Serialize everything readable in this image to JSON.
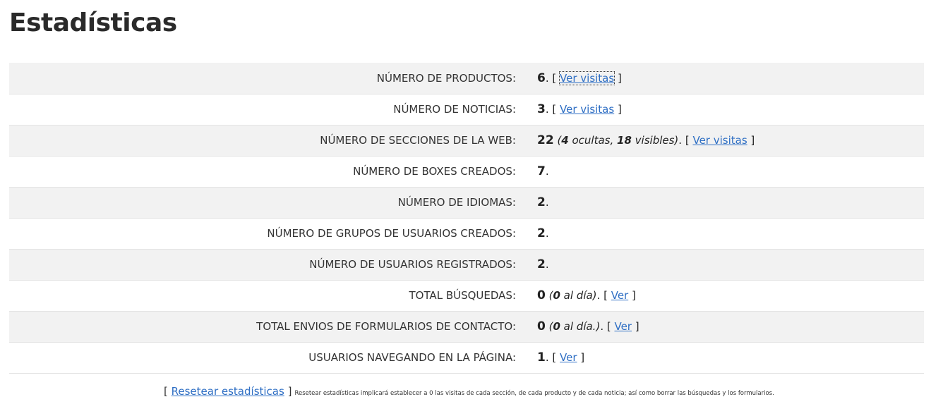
{
  "page": {
    "title": "Estadísticas"
  },
  "rows": [
    {
      "label": "NÚMERO DE PRODUCTOS:",
      "value": "6",
      "tail": ".",
      "link_open": " [ ",
      "link": "Ver visitas",
      "link_close": " ]"
    },
    {
      "label": "NÚMERO DE NOTICIAS:",
      "value": "3",
      "tail": ".",
      "link_open": " [ ",
      "link": "Ver visitas",
      "link_close": " ]"
    },
    {
      "label": "NÚMERO DE SECCIONES DE LA WEB:",
      "value": "22",
      "detail_open": " (",
      "hidden_count": "4",
      "hidden_text": " ocultas, ",
      "visible_count": "18",
      "visible_text": " visibles)",
      "tail": ".",
      "link_open": " [ ",
      "link": "Ver visitas",
      "link_close": " ]"
    },
    {
      "label": "NÚMERO DE BOXES CREADOS:",
      "value": "7",
      "tail": "."
    },
    {
      "label": "NÚMERO DE IDIOMAS:",
      "value": "2",
      "tail": "."
    },
    {
      "label": "NÚMERO DE GRUPOS DE USUARIOS CREADOS:",
      "value": "2",
      "tail": "."
    },
    {
      "label": "NÚMERO DE USUARIOS REGISTRADOS:",
      "value": "2",
      "tail": "."
    },
    {
      "label": "TOTAL BÚSQUEDAS:",
      "value": "0",
      "detail_open": " (",
      "per_day": "0",
      "per_day_text": " al día)",
      "tail": ".",
      "link_open": " [ ",
      "link": "Ver",
      "link_close": " ]"
    },
    {
      "label": "TOTAL ENVIOS DE FORMULARIOS DE CONTACTO:",
      "value": "0",
      "detail_open": " (",
      "per_day": "0",
      "per_day_text": " al día.)",
      "tail": ".",
      "link_open": " [ ",
      "link": "Ver",
      "link_close": " ]"
    },
    {
      "label": "USUARIOS NAVEGANDO EN LA PÁGINA:",
      "value": "1",
      "tail": ".",
      "link_open": " [ ",
      "link": "Ver",
      "link_close": " ]"
    }
  ],
  "footer": {
    "open": "[ ",
    "reset_link": "Resetear estadísticas",
    "close": " ]",
    "note": "Resetear estadísticas implicará establecer a 0 las visitas de cada sección, de cada producto y de cada noticia; así como borrar las búsquedas y los formularios."
  }
}
